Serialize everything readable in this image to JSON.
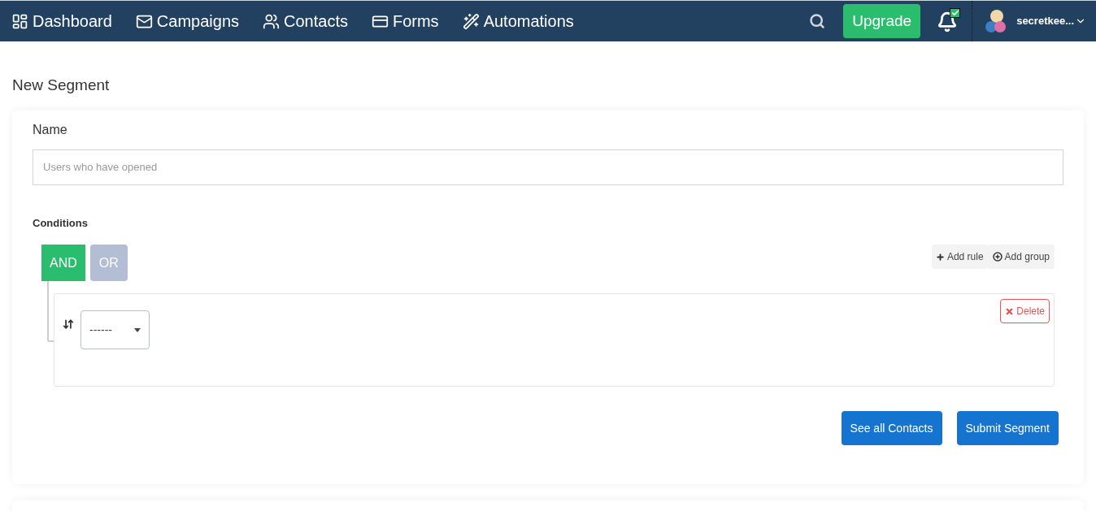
{
  "nav": {
    "items": [
      {
        "kind": "dashboard",
        "label": "Dashboard"
      },
      {
        "kind": "mail",
        "label": "Campaigns"
      },
      {
        "kind": "users",
        "label": "Contacts"
      },
      {
        "kind": "form",
        "label": "Forms"
      },
      {
        "kind": "wand",
        "label": "Automations"
      }
    ],
    "upgrade": "Upgrade",
    "notification_badge": true,
    "user": "secretkee..."
  },
  "page_title": "New Segment",
  "form": {
    "name_label": "Name",
    "name_placeholder": "Users who have opened",
    "conditions_label": "Conditions",
    "operators": [
      {
        "label": "AND",
        "selected": true
      },
      {
        "label": "OR",
        "selected": false
      }
    ],
    "add_rule": "Add rule",
    "add_group": "Add group",
    "rule": {
      "select_value": "------",
      "delete": "Delete"
    },
    "buttons": [
      "See all Contacts",
      "Submit Segment"
    ]
  }
}
